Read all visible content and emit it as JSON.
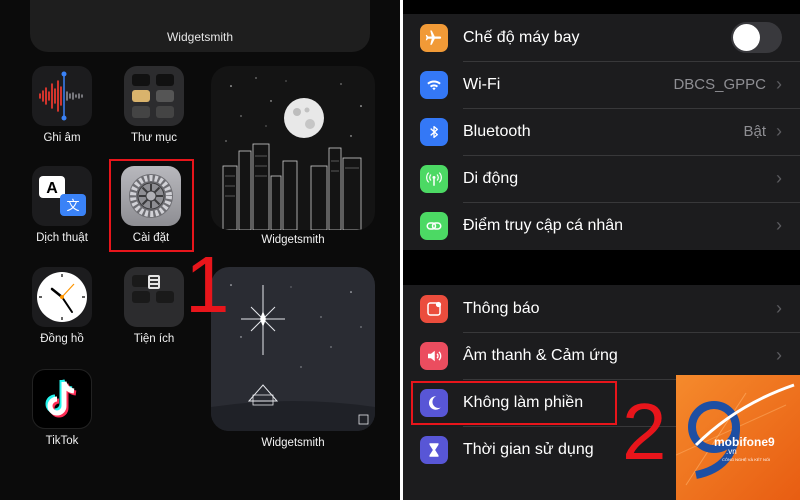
{
  "home": {
    "top_widget_label": "Widgetsmith",
    "apps": [
      {
        "label": "Ghi âm",
        "icon": "voice-memos-icon"
      },
      {
        "label": "Thư mục",
        "icon": "folder-icon"
      },
      {
        "label": "Dịch thuật",
        "icon": "translate-icon"
      },
      {
        "label": "Cài đặt",
        "icon": "settings-gear-icon"
      },
      {
        "label": "Đồng hồ",
        "icon": "clock-icon"
      },
      {
        "label": "Tiện ích",
        "icon": "utilities-icon"
      },
      {
        "label": "TikTok",
        "icon": "tiktok-icon"
      }
    ],
    "widgets": [
      {
        "label": "Widgetsmith"
      },
      {
        "label": "Widgetsmith"
      }
    ],
    "step_number": "1"
  },
  "settings": {
    "group1": [
      {
        "label": "Chế độ máy bay",
        "icon": "airplane-icon",
        "color": "#f19a37",
        "toggle": "off"
      },
      {
        "label": "Wi-Fi",
        "value": "DBCS_GPPC",
        "icon": "wifi-icon",
        "color": "#3478f6"
      },
      {
        "label": "Bluetooth",
        "value": "Bật",
        "icon": "bluetooth-icon",
        "color": "#3478f6"
      },
      {
        "label": "Di động",
        "icon": "cellular-icon",
        "color": "#4cd964"
      },
      {
        "label": "Điểm truy cập cá nhân",
        "icon": "hotspot-icon",
        "color": "#4cd964"
      }
    ],
    "group2": [
      {
        "label": "Thông báo",
        "icon": "notifications-icon",
        "color": "#eb4d3d"
      },
      {
        "label": "Âm thanh & Cảm ứng",
        "icon": "sound-icon",
        "color": "#eb4d5f"
      },
      {
        "label": "Không làm phiền",
        "icon": "moon-icon",
        "color": "#5856d6"
      },
      {
        "label": "Thời gian sử dụng",
        "icon": "hourglass-icon",
        "color": "#5856d6"
      }
    ],
    "step_number": "2"
  },
  "logo": {
    "brand": "mobifone9",
    "tld": ".vn",
    "tagline": "CÔNG NGHỆ VÀ KẾT NỐI"
  },
  "colors": {
    "highlight": "#e8151b",
    "logo_orange": "#f58a2c"
  }
}
